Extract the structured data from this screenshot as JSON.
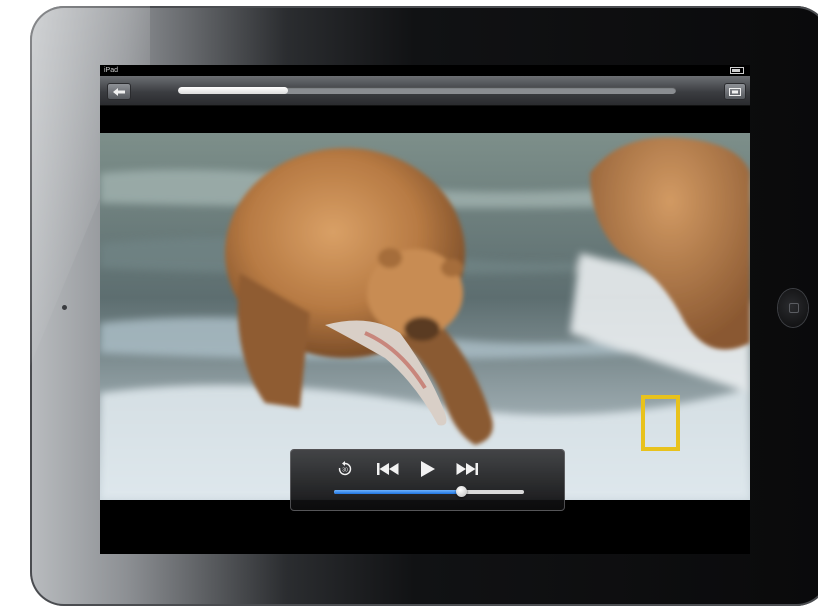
{
  "status_bar": {
    "carrier": "iPad",
    "time": "",
    "battery": ""
  },
  "scrub_bar": {
    "elapsed": "",
    "remaining": "",
    "progress": 0.22
  },
  "playback_controls": {
    "volume_level": 0.67
  },
  "icons": [
    "back-icon",
    "aspect-ratio-icon",
    "rewind-30-icon",
    "previous-track-icon",
    "play-icon",
    "next-track-icon",
    "home-button-icon"
  ],
  "colors": {
    "volume_accent": "#1f74e0",
    "logo_yellow": "#e8c21c"
  }
}
